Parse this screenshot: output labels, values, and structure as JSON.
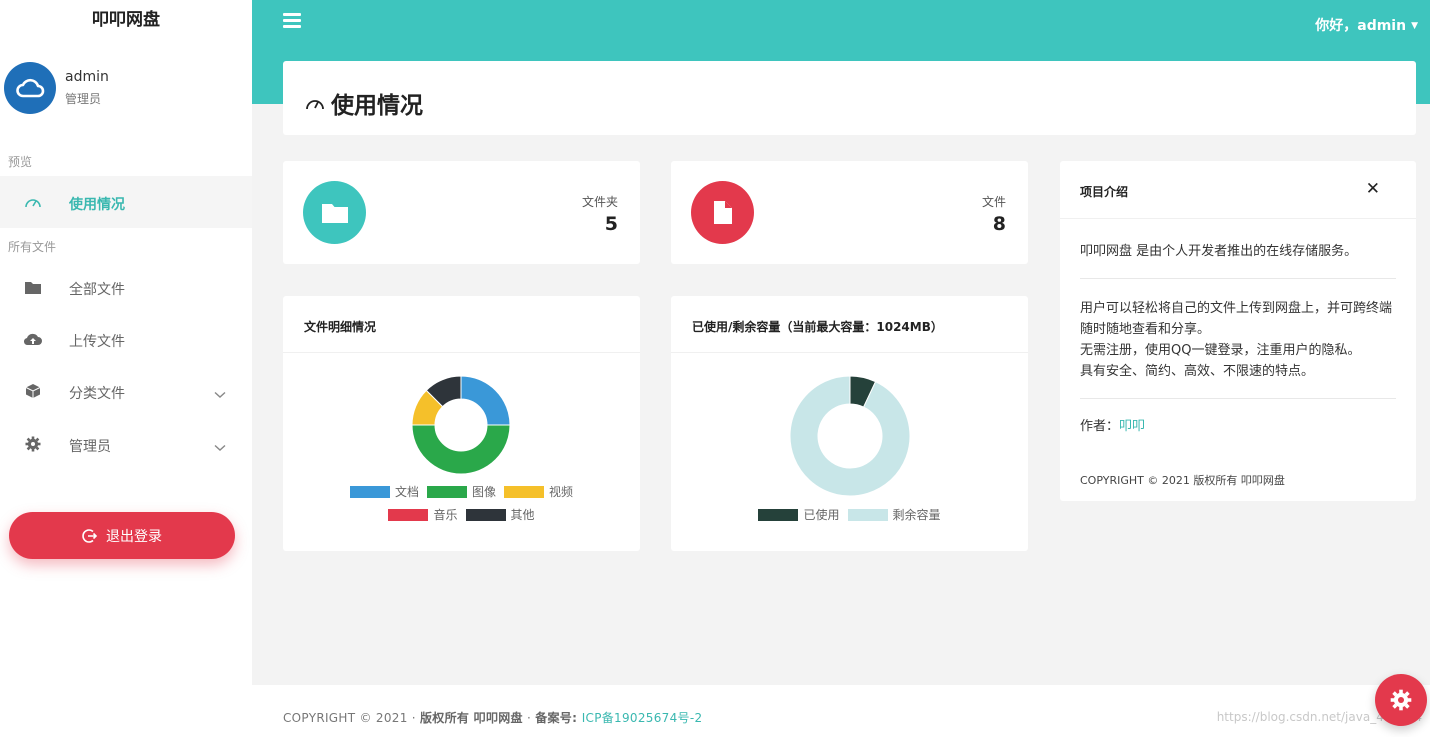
{
  "app": {
    "title": "叩叩网盘"
  },
  "user": {
    "name": "admin",
    "role": "管理员"
  },
  "sidebar": {
    "sections": [
      {
        "label": "预览"
      },
      {
        "label": "所有文件"
      }
    ],
    "items": [
      {
        "label": "使用情况",
        "icon": "gauge-icon",
        "active": true
      },
      {
        "label": "全部文件",
        "icon": "folder-icon"
      },
      {
        "label": "上传文件",
        "icon": "cloud-upload-icon"
      },
      {
        "label": "分类文件",
        "icon": "cube-icon",
        "has_submenu": true
      },
      {
        "label": "管理员",
        "icon": "gear-icon",
        "has_submenu": true
      }
    ],
    "logout_label": "退出登录"
  },
  "header": {
    "greeting": "你好，admin"
  },
  "page": {
    "title": "使用情况"
  },
  "stats": [
    {
      "label": "文件夹",
      "value": "5",
      "icon": "folder-icon",
      "color": "#3ec5be"
    },
    {
      "label": "文件",
      "value": "8",
      "icon": "file-icon",
      "color": "#e3394c"
    }
  ],
  "charts": {
    "file_detail": {
      "title": "文件明细情况"
    },
    "capacity": {
      "title": "已使用/剩余容量（当前最大容量：1024MB）"
    }
  },
  "chart_data": [
    {
      "type": "pie",
      "title": "文件明细情况",
      "donut": true,
      "categories": [
        "文档",
        "图像",
        "视频",
        "音乐",
        "其他"
      ],
      "values": [
        2,
        4,
        1,
        0,
        1
      ],
      "colors": [
        "#3a98d8",
        "#2aa84a",
        "#f5c02a",
        "#e3394c",
        "#2e343a"
      ],
      "legend": "bottom"
    },
    {
      "type": "pie",
      "title": "已使用/剩余容量（当前最大容量：1024MB）",
      "donut": true,
      "categories": [
        "已使用",
        "剩余容量"
      ],
      "values": [
        7,
        93
      ],
      "colors": [
        "#25413a",
        "#c8e6e8"
      ],
      "legend": "bottom"
    }
  ],
  "intro": {
    "title": "项目介绍",
    "close": "✕",
    "p1": "叩叩网盘 是由个人开发者推出的在线存储服务。",
    "p2": [
      "用户可以轻松将自己的文件上传到网盘上，并可跨终端随时随地查看和分享。",
      "无需注册，使用QQ一键登录，注重用户的隐私。",
      "具有安全、简约、高效、不限速的特点。"
    ],
    "author_label": "作者：",
    "author_name": "叩叩",
    "copyright": "COPYRIGHT © 2021 版权所有 叩叩网盘"
  },
  "footer": {
    "copyright": "COPYRIGHT © 2021 · ",
    "rights": "版权所有 叩叩网盘",
    "sep": " · ",
    "icp_label": "备案号: ",
    "icp_link": "ICP备19025674号-2",
    "watermark": "https://blog.csdn.net/java_412134"
  }
}
